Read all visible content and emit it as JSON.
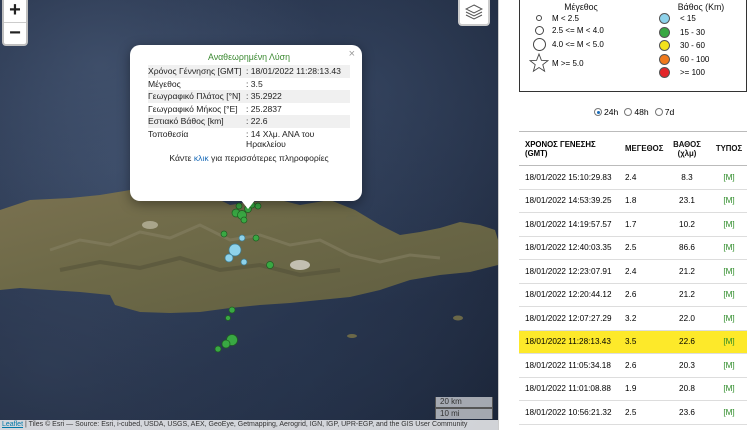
{
  "map": {
    "zoom_in": "+",
    "zoom_out": "−",
    "layers_icon": "layers-icon",
    "popup": {
      "title": "Αναθεωρημένη Λύση",
      "close": "×",
      "rows": [
        {
          "key": "Χρόνος Γέννησης [GMT]",
          "value": ": 18/01/2022 11:28:13.43"
        },
        {
          "key": "Μέγεθος",
          "value": ": 3.5"
        },
        {
          "key": "Γεωγραφικό Πλάτος [°N]",
          "value": ": 35.2922"
        },
        {
          "key": "Γεωγραφικό Μήκος [°E]",
          "value": ": 25.2837"
        },
        {
          "key": "Εστιακό Βάθος [km]",
          "value": ": 22.6"
        },
        {
          "key": "Τοποθεσία",
          "value": ": 14 Χλμ. ΑΝΑ του Ηρακλείου"
        }
      ],
      "more_prefix": "Κάντε ",
      "more_link": "κλικ",
      "more_suffix": " για περισσότερες πληροφορίες"
    },
    "scale_km": "20 km",
    "scale_mi": "10 mi",
    "attribution_link": "Leaflet",
    "attribution_text": " | Tiles © Esri — Source: Esri, i-cubed, USDA, USGS, AEX, GeoEye, Getmapping, Aerogrid, IGN, IGP, UPR-EGP, and the GIS User Community"
  },
  "legend": {
    "magnitude_title": "Μέγεθος",
    "magnitude": [
      {
        "label": "M < 2.5"
      },
      {
        "label": "2.5 <= M < 4.0"
      },
      {
        "label": "4.0 <= M < 5.0"
      },
      {
        "label": "M >= 5.0"
      }
    ],
    "depth_title": "Βάθος (Km)",
    "depth": [
      {
        "label": "< 15",
        "color": "#8ed2ea"
      },
      {
        "label": "15 - 30",
        "color": "#39a843"
      },
      {
        "label": "30 - 60",
        "color": "#f2e11c"
      },
      {
        "label": "60 - 100",
        "color": "#f07a1d"
      },
      {
        "label": ">= 100",
        "color": "#e3262a"
      }
    ]
  },
  "period": {
    "options": [
      "24h",
      "48h",
      "7d"
    ],
    "selected": "24h"
  },
  "events": {
    "headers": {
      "time": "ΧΡΟΝΟΣ ΓΕΝΕΣΗΣ (GMT)",
      "magnitude": "ΜΕΓΕΘΟΣ",
      "depth": "ΒΑΘΟΣ (χλμ)",
      "type": "ΤΥΠΟΣ"
    },
    "rows": [
      {
        "time": "18/01/2022 15:10:29.83",
        "mag": "2.4",
        "depth": "8.3",
        "type": "[M]",
        "hl": false
      },
      {
        "time": "18/01/2022 14:53:39.25",
        "mag": "1.8",
        "depth": "23.1",
        "type": "[M]",
        "hl": false
      },
      {
        "time": "18/01/2022 14:19:57.57",
        "mag": "1.7",
        "depth": "10.2",
        "type": "[M]",
        "hl": false
      },
      {
        "time": "18/01/2022 12:40:03.35",
        "mag": "2.5",
        "depth": "86.6",
        "type": "[M]",
        "hl": false
      },
      {
        "time": "18/01/2022 12:23:07.91",
        "mag": "2.4",
        "depth": "21.2",
        "type": "[M]",
        "hl": false
      },
      {
        "time": "18/01/2022 12:20:44.12",
        "mag": "2.6",
        "depth": "21.2",
        "type": "[M]",
        "hl": false
      },
      {
        "time": "18/01/2022 12:07:27.29",
        "mag": "3.2",
        "depth": "22.0",
        "type": "[M]",
        "hl": false
      },
      {
        "time": "18/01/2022 11:28:13.43",
        "mag": "3.5",
        "depth": "22.6",
        "type": "[M]",
        "hl": true
      },
      {
        "time": "18/01/2022 11:05:34.18",
        "mag": "2.6",
        "depth": "20.3",
        "type": "[M]",
        "hl": false
      },
      {
        "time": "18/01/2022 11:01:08.88",
        "mag": "1.9",
        "depth": "20.8",
        "type": "[M]",
        "hl": false
      },
      {
        "time": "18/01/2022 10:56:21.32",
        "mag": "2.5",
        "depth": "23.6",
        "type": "[M]",
        "hl": false
      }
    ]
  }
}
